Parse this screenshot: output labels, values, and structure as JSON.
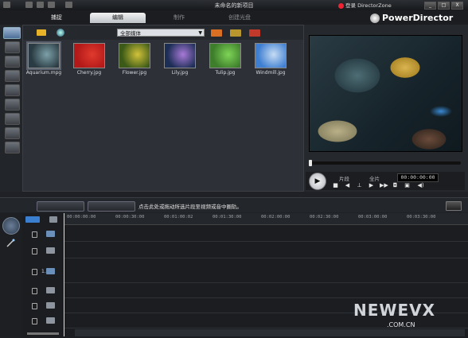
{
  "window": {
    "title": "未命名的新项目",
    "login_label": "登录 DirectorZone",
    "brand": "PowerDirector",
    "controls": [
      "_",
      "□",
      "X"
    ]
  },
  "tabs": [
    {
      "label": "捕捉",
      "active": false
    },
    {
      "label": "编辑",
      "active": true
    },
    {
      "label": "制作",
      "active": false
    },
    {
      "label": "创建光盘",
      "active": false
    }
  ],
  "library": {
    "filter_value": "全部媒体",
    "items": [
      {
        "label": "Aquarium.mpg",
        "colors": [
          "#2a3b43",
          "#7da0a8"
        ],
        "selected": true
      },
      {
        "label": "Cherry.jpg",
        "colors": [
          "#b31919",
          "#e03a2d"
        ],
        "selected": false
      },
      {
        "label": "Flower.jpg",
        "colors": [
          "#3c5a17",
          "#d2c23a"
        ],
        "selected": false
      },
      {
        "label": "Lily.jpg",
        "colors": [
          "#1c2e55",
          "#a879d8"
        ],
        "selected": false
      },
      {
        "label": "Tulip.jpg",
        "colors": [
          "#3d7d2b",
          "#7ed457"
        ],
        "selected": false
      },
      {
        "label": "Windmill.jpg",
        "colors": [
          "#3f7fd2",
          "#c6dcf3"
        ],
        "selected": false
      }
    ]
  },
  "preview": {
    "mode_clip": "片段",
    "mode_movie": "全片",
    "timecode": "00:00:00:00"
  },
  "timeline": {
    "hint": "点击此处或拖动所选片段至视频或音中圈轨。",
    "ruler": [
      "00:00:00:00",
      "00:00:30:00",
      "00:01:00:02",
      "00:01:30:00",
      "00:02:00:00",
      "00:02:30:00",
      "00:03:00:00",
      "00:03:30:00"
    ],
    "track_number": "1."
  },
  "watermark": {
    "logo": "NEWEVX",
    "domain": ".COM.CN"
  }
}
